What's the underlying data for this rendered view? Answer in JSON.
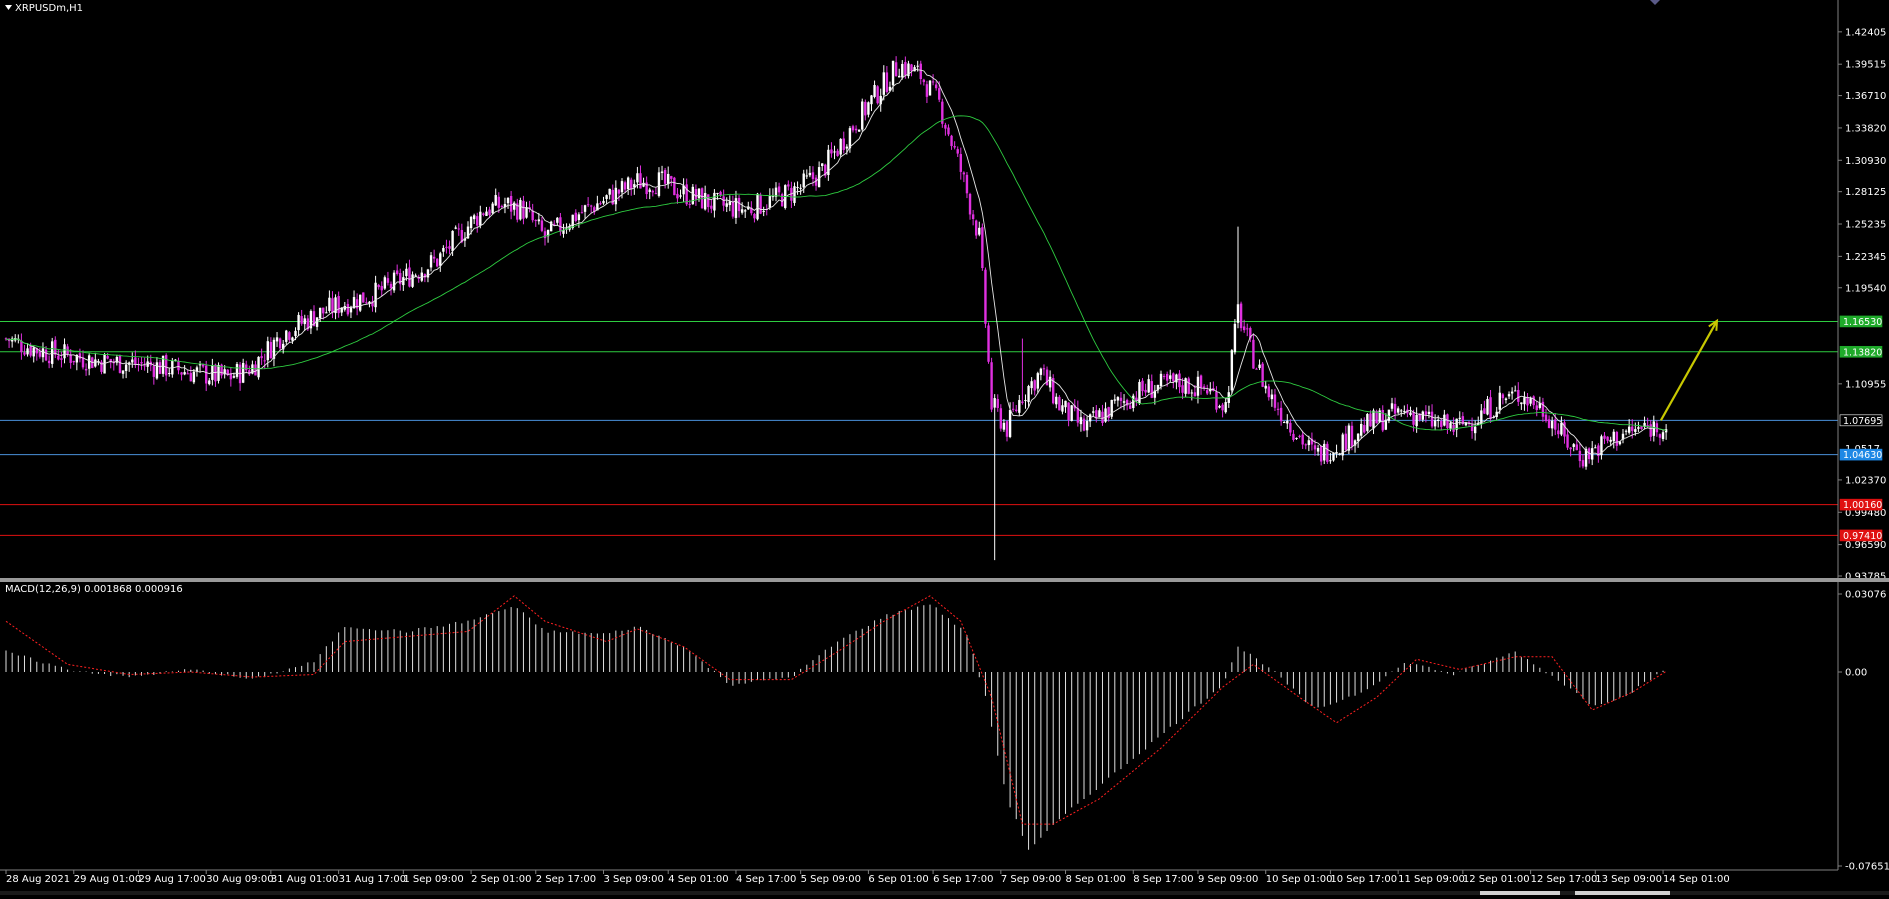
{
  "header": {
    "symbol_label": "XRPUSDm,H1",
    "macd_label": "MACD(12,26,9) 0.001868 0.000916"
  },
  "colors": {
    "background": "#000000",
    "candle_bull": "#ffffff",
    "candle_bear": "#e030e0",
    "ma_fast": "#e6e6e6",
    "ma_slow": "#2ecc40",
    "macd_hist": "#e0e0e0",
    "macd_signal": "#ff2020",
    "hl_green": "#2ecc40",
    "hl_blue": "#4a90d9",
    "hl_red": "#e01010",
    "arrow": "#c8c800",
    "separator": "#808080"
  },
  "price_axis": {
    "ticks": [
      "1.42405",
      "1.39515",
      "1.36710",
      "1.33820",
      "1.30930",
      "1.28125",
      "1.25235",
      "1.22345",
      "1.19540",
      "1.10955",
      "1.02370",
      "0.99480",
      "0.96590",
      "0.93785"
    ],
    "current_price_label": "1.07695",
    "partial_label": "1.0517",
    "range": [
      0.93785,
      1.44
    ]
  },
  "macd_axis": {
    "ticks": [
      "0.03076",
      "0.00",
      "-0.07651"
    ],
    "range": [
      -0.07651,
      0.03076
    ]
  },
  "time_axis": {
    "labels": [
      "28 Aug 2021",
      "29 Aug 01:00",
      "29 Aug 17:00",
      "30 Aug 09:00",
      "31 Aug 01:00",
      "31 Aug 17:00",
      "1 Sep 09:00",
      "2 Sep 01:00",
      "2 Sep 17:00",
      "3 Sep 09:00",
      "4 Sep 01:00",
      "4 Sep 17:00",
      "5 Sep 09:00",
      "6 Sep 01:00",
      "6 Sep 17:00",
      "7 Sep 09:00",
      "8 Sep 01:00",
      "8 Sep 17:00",
      "9 Sep 09:00",
      "10 Sep 01:00",
      "10 Sep 17:00",
      "11 Sep 09:00",
      "12 Sep 01:00",
      "12 Sep 17:00",
      "13 Sep 09:00",
      "14 Sep 01:00"
    ]
  },
  "horizontal_lines": [
    {
      "price": 1.1653,
      "label": "1.16530",
      "color": "#2ecc40",
      "badge": "#1faa2a"
    },
    {
      "price": 1.1382,
      "label": "1.13820",
      "color": "#2ecc40",
      "badge": "#1faa2a"
    },
    {
      "price": 1.07695,
      "label": "1.07695",
      "color": "#4a90d9",
      "badge": "#000000"
    },
    {
      "price": 1.0463,
      "label": "1.04630",
      "color": "#4a90d9",
      "badge": "#1e88e5"
    },
    {
      "price": 1.0016,
      "label": "1.00160",
      "color": "#e01010",
      "badge": "#e01010"
    },
    {
      "price": 0.9741,
      "label": "0.97410",
      "color": "#e01010",
      "badge": "#e01010"
    }
  ],
  "chart_data": [
    {
      "type": "candlestick",
      "title": "XRPUSDm,H1",
      "x_labels": [
        "28 Aug 2021",
        "29 Aug 01:00",
        "29 Aug 17:00",
        "30 Aug 09:00",
        "31 Aug 01:00",
        "31 Aug 17:00",
        "1 Sep 09:00",
        "2 Sep 01:00",
        "2 Sep 17:00",
        "3 Sep 09:00",
        "4 Sep 01:00",
        "4 Sep 17:00",
        "5 Sep 09:00",
        "6 Sep 01:00",
        "6 Sep 17:00",
        "7 Sep 09:00",
        "8 Sep 01:00",
        "8 Sep 17:00",
        "9 Sep 09:00",
        "10 Sep 01:00",
        "10 Sep 17:00",
        "11 Sep 09:00",
        "12 Sep 01:00",
        "12 Sep 17:00",
        "13 Sep 09:00",
        "14 Sep 01:00"
      ],
      "close_path": [
        [
          0,
          1.15
        ],
        [
          10,
          1.14
        ],
        [
          20,
          1.135
        ],
        [
          30,
          1.13
        ],
        [
          40,
          1.128
        ],
        [
          50,
          1.125
        ],
        [
          60,
          1.12
        ],
        [
          72,
          1.115
        ],
        [
          80,
          1.125
        ],
        [
          90,
          1.155
        ],
        [
          100,
          1.17
        ],
        [
          108,
          1.18
        ],
        [
          120,
          1.19
        ],
        [
          130,
          1.205
        ],
        [
          140,
          1.22
        ],
        [
          148,
          1.245
        ],
        [
          155,
          1.265
        ],
        [
          162,
          1.27
        ],
        [
          168,
          1.265
        ],
        [
          175,
          1.24
        ],
        [
          185,
          1.26
        ],
        [
          195,
          1.275
        ],
        [
          205,
          1.29
        ],
        [
          212,
          1.29
        ],
        [
          220,
          1.28
        ],
        [
          230,
          1.27
        ],
        [
          240,
          1.265
        ],
        [
          250,
          1.275
        ],
        [
          258,
          1.285
        ],
        [
          265,
          1.3
        ],
        [
          275,
          1.34
        ],
        [
          283,
          1.37
        ],
        [
          290,
          1.395
        ],
        [
          297,
          1.385
        ],
        [
          303,
          1.36
        ],
        [
          310,
          1.3
        ],
        [
          316,
          1.24
        ],
        [
          320,
          1.09
        ],
        [
          325,
          1.07
        ],
        [
          330,
          1.1
        ],
        [
          336,
          1.12
        ],
        [
          342,
          1.09
        ],
        [
          350,
          1.07
        ],
        [
          360,
          1.09
        ],
        [
          370,
          1.105
        ],
        [
          380,
          1.11
        ],
        [
          390,
          1.105
        ],
        [
          396,
          1.09
        ],
        [
          400,
          1.175
        ],
        [
          404,
          1.14
        ],
        [
          410,
          1.1
        ],
        [
          418,
          1.07
        ],
        [
          425,
          1.045
        ],
        [
          432,
          1.055
        ],
        [
          440,
          1.07
        ],
        [
          448,
          1.08
        ],
        [
          455,
          1.085
        ],
        [
          463,
          1.075
        ],
        [
          470,
          1.07
        ],
        [
          478,
          1.08
        ],
        [
          485,
          1.095
        ],
        [
          492,
          1.1
        ],
        [
          500,
          1.085
        ],
        [
          506,
          1.06
        ],
        [
          512,
          1.045
        ],
        [
          518,
          1.055
        ],
        [
          525,
          1.065
        ],
        [
          532,
          1.07
        ],
        [
          537,
          1.072
        ],
        [
          540,
          1.072
        ]
      ],
      "price_range": [
        0.93785,
        1.44
      ],
      "overlays": [
        "moving average (fast)",
        "moving average (slow)"
      ],
      "arrow": {
        "from_price": 1.0769,
        "to_price": 1.165,
        "direction": "up"
      }
    },
    {
      "type": "macd",
      "title": "MACD(12,26,9) 0.001868 0.000916",
      "value_path": [
        [
          0,
          0.008
        ],
        [
          20,
          0.001
        ],
        [
          40,
          -0.002
        ],
        [
          60,
          0.001
        ],
        [
          80,
          -0.003
        ],
        [
          100,
          0.004
        ],
        [
          110,
          0.018
        ],
        [
          130,
          0.016
        ],
        [
          150,
          0.02
        ],
        [
          165,
          0.026
        ],
        [
          175,
          0.016
        ],
        [
          195,
          0.015
        ],
        [
          205,
          0.018
        ],
        [
          220,
          0.01
        ],
        [
          235,
          -0.005
        ],
        [
          255,
          -0.002
        ],
        [
          270,
          0.012
        ],
        [
          285,
          0.022
        ],
        [
          300,
          0.027
        ],
        [
          312,
          0.015
        ],
        [
          318,
          -0.01
        ],
        [
          325,
          -0.05
        ],
        [
          332,
          -0.07
        ],
        [
          345,
          -0.055
        ],
        [
          360,
          -0.04
        ],
        [
          380,
          -0.02
        ],
        [
          395,
          -0.005
        ],
        [
          400,
          0.01
        ],
        [
          410,
          0.002
        ],
        [
          425,
          -0.015
        ],
        [
          440,
          -0.008
        ],
        [
          455,
          0.004
        ],
        [
          470,
          -0.001
        ],
        [
          490,
          0.008
        ],
        [
          505,
          -0.004
        ],
        [
          515,
          -0.013
        ],
        [
          525,
          -0.01
        ],
        [
          540,
          0.002
        ]
      ],
      "signal_path": [
        [
          0,
          0.02
        ],
        [
          20,
          0.003
        ],
        [
          40,
          -0.001
        ],
        [
          60,
          0.0
        ],
        [
          80,
          -0.002
        ],
        [
          100,
          -0.001
        ],
        [
          110,
          0.012
        ],
        [
          130,
          0.014
        ],
        [
          150,
          0.016
        ],
        [
          165,
          0.03
        ],
        [
          175,
          0.02
        ],
        [
          195,
          0.012
        ],
        [
          205,
          0.017
        ],
        [
          220,
          0.01
        ],
        [
          235,
          -0.003
        ],
        [
          255,
          -0.003
        ],
        [
          270,
          0.008
        ],
        [
          285,
          0.02
        ],
        [
          300,
          0.03
        ],
        [
          310,
          0.02
        ],
        [
          320,
          -0.01
        ],
        [
          330,
          -0.06
        ],
        [
          340,
          -0.06
        ],
        [
          355,
          -0.05
        ],
        [
          375,
          -0.03
        ],
        [
          395,
          -0.006
        ],
        [
          405,
          0.003
        ],
        [
          420,
          -0.01
        ],
        [
          432,
          -0.02
        ],
        [
          445,
          -0.01
        ],
        [
          458,
          0.005
        ],
        [
          472,
          0.001
        ],
        [
          490,
          0.006
        ],
        [
          502,
          0.006
        ],
        [
          515,
          -0.015
        ],
        [
          528,
          -0.008
        ],
        [
          540,
          0.001
        ]
      ],
      "hist_last": 0.001868,
      "signal_last": 0.000916,
      "value_range": [
        -0.07651,
        0.03076
      ]
    }
  ]
}
